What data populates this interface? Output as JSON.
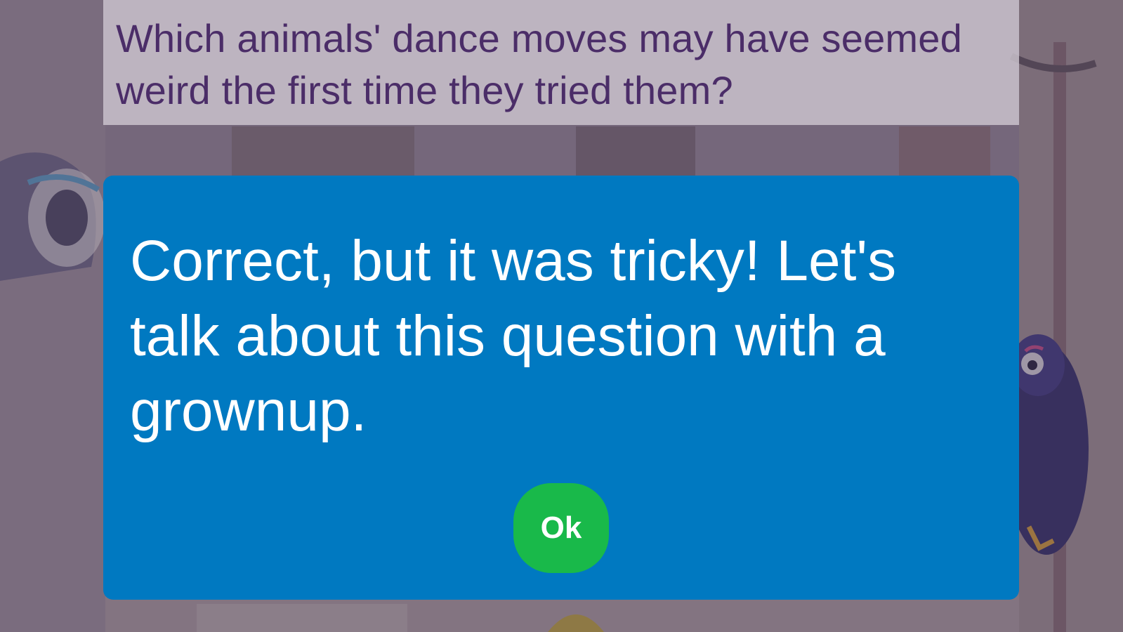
{
  "question": {
    "text": "Which animals' dance moves may have seemed weird the first time they tried them?"
  },
  "feedback_modal": {
    "message": "Correct, but it was tricky! Let's talk about this question with a grownup.",
    "ok_label": "Ok"
  },
  "colors": {
    "modal_background": "#0079c1",
    "ok_button": "#19b94a",
    "question_text": "#4b2d68"
  }
}
